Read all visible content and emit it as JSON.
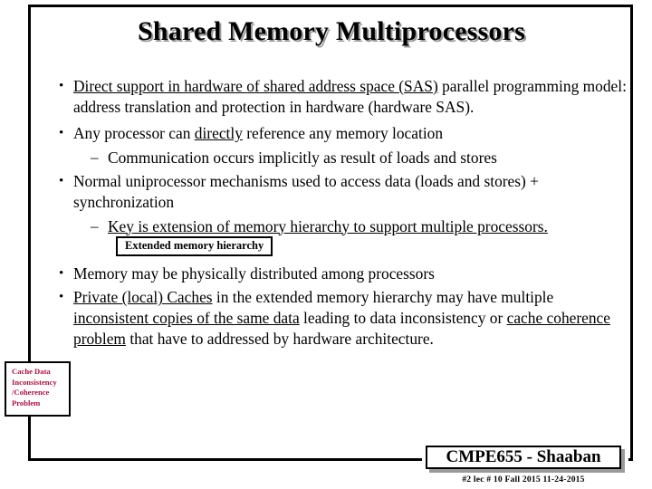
{
  "slide": {
    "title": "Shared Memory Multiprocessors",
    "accent_red": "#b01040",
    "shadow_gray": "#9a9a9a"
  },
  "bullets": [
    {
      "level": 1,
      "marker": "•",
      "underlined_lead": "Direct support in hardware of shared address space (SAS)",
      "rest": " parallel programming model: address translation and protection in hardware (hardware SAS)."
    },
    {
      "level": 1,
      "marker": "•",
      "pre": "Any processor can ",
      "underlined_mid": "directly",
      "post": " reference any memory location"
    },
    {
      "level": 2,
      "marker": "–",
      "text": "Communication occurs implicitly as result of loads and stores"
    },
    {
      "level": 1,
      "marker": "•",
      "text": "Normal uniprocessor mechanisms used to access data (loads and stores) + synchronization"
    },
    {
      "level": 2,
      "marker": "–",
      "underlined_lead": "Key is extension of memory hierarchy to support multiple processors.",
      "callout": "Extended memory hierarchy"
    },
    {
      "level": 1,
      "marker": "•",
      "text": "Memory may be physically distributed among processors"
    },
    {
      "level": 1,
      "marker": "•",
      "underlined_lead": "Private (local) Caches",
      "mid1": " in the extended memory hierarchy may have multiple ",
      "underlined_mid2": "inconsistent copies of the same data",
      "mid2": " leading to data inconsistency or ",
      "underlined_mid3": "cache coherence problem",
      "post": " that have to addressed by hardware architecture."
    }
  ],
  "callouts": {
    "extended_memory_hierarchy": "Extended memory hierarchy",
    "cache_inconsistency": {
      "line1": "Cache Data",
      "line2": "Inconsistency",
      "line3": "/Coherence",
      "line4": "Problem"
    }
  },
  "footer": {
    "course": "CMPE655 - Shaaban",
    "meta": "#2   lec # 10   Fall 2015   11-24-2015"
  }
}
